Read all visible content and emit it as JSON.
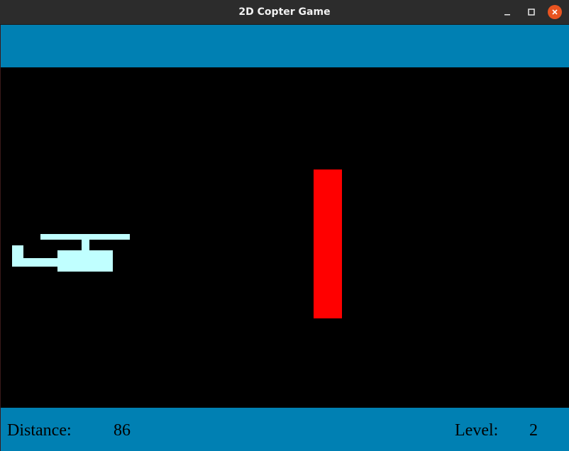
{
  "window": {
    "title": "2D Copter Game",
    "controls": {
      "minimize_icon": "minimize-icon",
      "maximize_icon": "maximize-icon",
      "close_icon": "close-icon"
    }
  },
  "colors": {
    "hud_bar": "#0080b3",
    "playfield": "#000000",
    "copter": "#c0ffff",
    "obstacle": "#ff0000",
    "close_button": "#e95420"
  },
  "hud": {
    "distance_label": "Distance:",
    "distance_value": "86",
    "level_label": "Level:",
    "level_value": "2"
  }
}
